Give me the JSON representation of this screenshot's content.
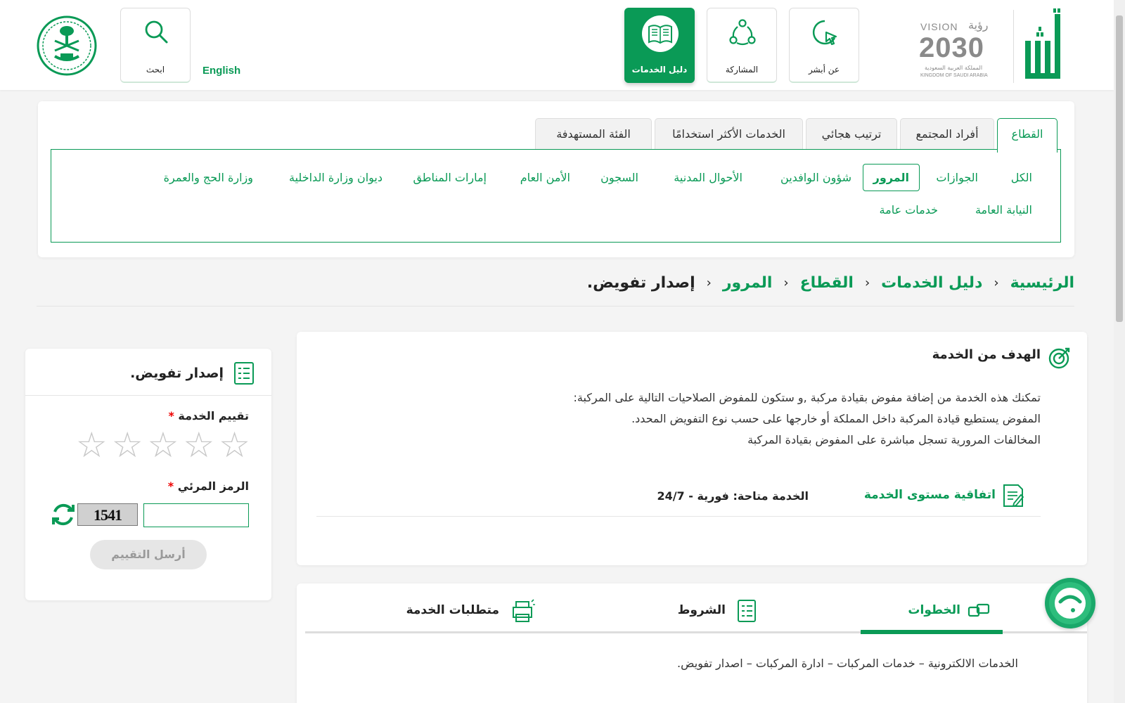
{
  "header": {
    "nav": [
      {
        "label": "عن أبشر",
        "icon": "cursor-click-icon"
      },
      {
        "label": "المشاركة",
        "icon": "network-icon"
      },
      {
        "label": "دليل الخدمات",
        "icon": "book-icon",
        "active": true
      }
    ],
    "search_label": "ابحث",
    "language_link": "English",
    "vision": {
      "line1": "VISION",
      "line1_ar": "رؤية",
      "year": "2030",
      "ar_kingdom": "المملكة العربية السعودية",
      "en_kingdom": "KINGDOM OF SAUDI ARABIA"
    }
  },
  "tabs": [
    {
      "label": "القطاع",
      "active": true
    },
    {
      "label": "أفراد المجتمع"
    },
    {
      "label": "ترتيب هجائي"
    },
    {
      "label": "الخدمات الأكثر استخدامًا"
    },
    {
      "label": "الفئة المستهدفة"
    }
  ],
  "sectors": {
    "row1": [
      "الكل",
      "الجوازات",
      "المرور",
      "شؤون الوافدين",
      "الأحوال المدنية",
      "السجون",
      "الأمن العام",
      "إمارات المناطق",
      "ديوان وزارة الداخلية",
      "وزارة الحج والعمرة"
    ],
    "row2": [
      "النيابة العامة",
      "خدمات عامة"
    ],
    "active": "المرور"
  },
  "breadcrumb": {
    "items": [
      "الرئيسية",
      "دليل الخدمات",
      "القطاع",
      "المرور"
    ],
    "current": "إصدار تفويض."
  },
  "goal": {
    "title": "الهدف من الخدمة",
    "lines": [
      "تمكنك هذه الخدمة من إضافة مفوض بقيادة مركبة ,و ستكون للمفوض الصلاحيات التالية على المركبة:",
      "المفوض يستطيع قيادة المركبة داخل المملكة أو خارجها على حسب نوع التفويض المحدد.",
      "المخالفات المرورية تسجل مباشرة على المفوض بقيادة المركبة"
    ],
    "sla_label": "اتفاقية مستوى الخدمة",
    "availability": "الخدمة متاحة: فورية - 24/7"
  },
  "lower": {
    "tabs": [
      "الخطوات",
      "الشروط",
      "متطلبات الخدمة"
    ],
    "active": "الخطوات",
    "path": "الخدمات الالكترونية – خدمات المركبات – ادارة المركبات – اصدار تفويض."
  },
  "rating": {
    "title": "إصدار تفويض.",
    "rating_label": "تقييم الخدمة",
    "required_mark": "*",
    "stars": 5,
    "captcha_label": "الرمز المرئي",
    "captcha_text": "1541",
    "captcha_value": "",
    "submit_label": "أرسل التقييم"
  },
  "colors": {
    "brand": "#0a9a56",
    "required": "#e00000"
  }
}
